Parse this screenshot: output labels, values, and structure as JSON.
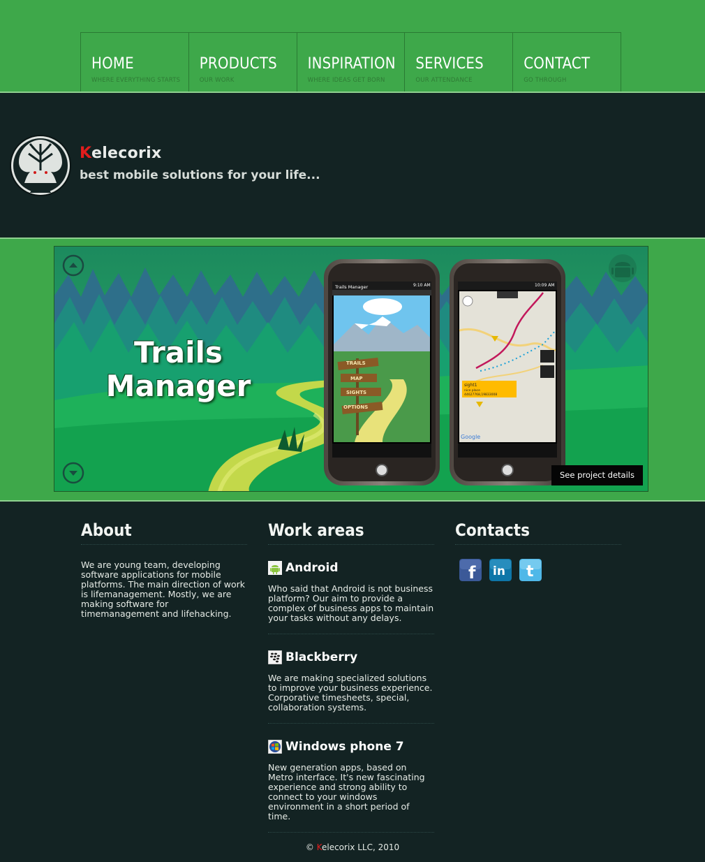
{
  "nav": [
    {
      "title": "HOME",
      "sub": "WHERE EVERYTHING STARTS"
    },
    {
      "title": "PRODUCTS",
      "sub": "OUR WORK"
    },
    {
      "title": "INSPIRATION",
      "sub": "WHERE IDEAS GET BORN"
    },
    {
      "title": "SERVICES",
      "sub": "OUR ATTENDANCE"
    },
    {
      "title": "CONTACT",
      "sub": "GO THROUGH"
    }
  ],
  "brand": {
    "first_letter": "K",
    "rest": "elecorix",
    "slogan": "best mobile solutions for your life..."
  },
  "banner": {
    "title_line1": "Trails",
    "title_line2": "Manager",
    "details_button": "See project details",
    "phone1_app_title": "Trails Manager",
    "phone1_time": "9:10 AM",
    "phone2_time": "10:09 AM",
    "menu_items": [
      "TRAILS",
      "MAP",
      "SIGHTS",
      "OPTIONS"
    ],
    "map_popup_title": "sight1",
    "map_popup_line2": "nice place",
    "map_popup_line3": "44627768,19833008",
    "map_brand": "Google"
  },
  "about": {
    "heading": "About",
    "text": "We are young team, developing software applications for mobile platforms. The main direction of work is lifemanagement. Mostly, we are making software for timemanagement and lifehacking."
  },
  "work_areas": {
    "heading": "Work areas",
    "items": [
      {
        "title": "Android",
        "icon": "android-icon",
        "text": "Who said that Android is not business platform? Our aim to provide a complex of business apps to maintain your tasks without any delays."
      },
      {
        "title": "Blackberry",
        "icon": "blackberry-icon",
        "text": "We are making specialized solutions to improve your business experience. Corporative timesheets, special, collaboration systems."
      },
      {
        "title": "Windows phone 7",
        "icon": "windows-icon",
        "text": "New generation apps, based on Metro interface. It's new fascinating experience and strong ability to connect to your windows environment in a short period of time."
      }
    ]
  },
  "contacts": {
    "heading": "Contacts",
    "social": [
      {
        "name": "facebook-icon",
        "label": "f",
        "color": "#3b5998"
      },
      {
        "name": "linkedin-icon",
        "label": "in",
        "color": "#0e76a8"
      },
      {
        "name": "twitter-icon",
        "label": "t",
        "color": "#4fb8e8"
      }
    ]
  },
  "footer": {
    "copyright": "©",
    "first_letter": "K",
    "rest": "elecorix LLC, 2010"
  },
  "colors": {
    "green": "#3ea84a",
    "dark": "#132323",
    "brand_red": "#e21d1d"
  }
}
